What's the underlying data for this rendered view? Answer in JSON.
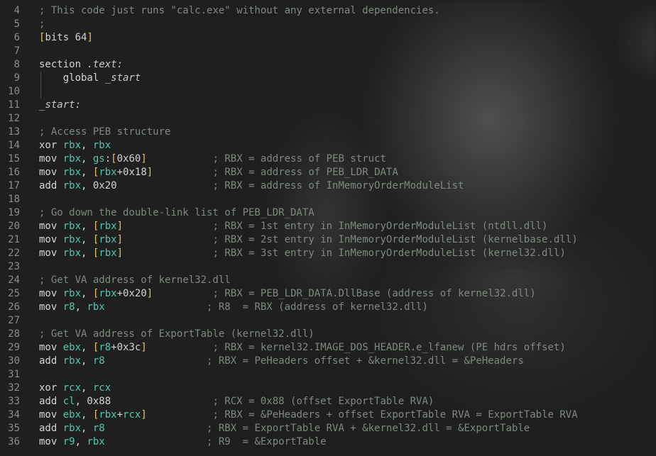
{
  "editor": {
    "lines": [
      {
        "n": "4",
        "segments": [
          {
            "t": "; This code just runs \"calc.exe\" without any external dependencies.",
            "c": "cmt"
          }
        ]
      },
      {
        "n": "5",
        "segments": [
          {
            "t": ";",
            "c": "cmt"
          }
        ]
      },
      {
        "n": "6",
        "segments": [
          {
            "t": "[",
            "c": "br"
          },
          {
            "t": "bits 64",
            "c": "plain"
          },
          {
            "t": "]",
            "c": "br"
          }
        ]
      },
      {
        "n": "7",
        "segments": []
      },
      {
        "n": "8",
        "segments": [
          {
            "t": "section ",
            "c": "plain"
          },
          {
            "t": ".text:",
            "c": "lbl"
          }
        ]
      },
      {
        "n": "9",
        "segments": [
          {
            "t": "    global ",
            "c": "plain"
          },
          {
            "t": "_start",
            "c": "lbl"
          }
        ]
      },
      {
        "n": "10",
        "segments": []
      },
      {
        "n": "11",
        "segments": [
          {
            "t": "_start:",
            "c": "lbl"
          }
        ]
      },
      {
        "n": "12",
        "segments": []
      },
      {
        "n": "13",
        "segments": [
          {
            "t": "; Access PEB structure",
            "c": "cmt"
          }
        ]
      },
      {
        "n": "14",
        "segments": [
          {
            "t": "xor ",
            "c": "kw"
          },
          {
            "t": "rbx",
            "c": "reg"
          },
          {
            "t": ", ",
            "c": "plain"
          },
          {
            "t": "rbx",
            "c": "reg"
          }
        ]
      },
      {
        "n": "15",
        "segments": [
          {
            "t": "mov ",
            "c": "kw"
          },
          {
            "t": "rbx",
            "c": "reg"
          },
          {
            "t": ", ",
            "c": "plain"
          },
          {
            "t": "gs",
            "c": "reg"
          },
          {
            "t": ":",
            "c": "plain"
          },
          {
            "t": "[",
            "c": "br"
          },
          {
            "t": "0x60",
            "c": "num"
          },
          {
            "t": "]",
            "c": "br"
          },
          {
            "t": "           ; RBX = address of PEB struct",
            "c": "cmt"
          }
        ]
      },
      {
        "n": "16",
        "segments": [
          {
            "t": "mov ",
            "c": "kw"
          },
          {
            "t": "rbx",
            "c": "reg"
          },
          {
            "t": ", ",
            "c": "plain"
          },
          {
            "t": "[",
            "c": "br"
          },
          {
            "t": "rbx",
            "c": "reg"
          },
          {
            "t": "+0x18",
            "c": "num"
          },
          {
            "t": "]",
            "c": "br"
          },
          {
            "t": "          ; RBX = address of PEB_LDR_DATA",
            "c": "cmt"
          }
        ]
      },
      {
        "n": "17",
        "segments": [
          {
            "t": "add ",
            "c": "kw"
          },
          {
            "t": "rbx",
            "c": "reg"
          },
          {
            "t": ", 0x20",
            "c": "num"
          },
          {
            "t": "                ; RBX = address of InMemoryOrderModuleList",
            "c": "cmt"
          }
        ]
      },
      {
        "n": "18",
        "segments": []
      },
      {
        "n": "19",
        "segments": [
          {
            "t": "; Go down the double-link list of PEB_LDR_DATA",
            "c": "cmt"
          }
        ]
      },
      {
        "n": "20",
        "segments": [
          {
            "t": "mov ",
            "c": "kw"
          },
          {
            "t": "rbx",
            "c": "reg"
          },
          {
            "t": ", ",
            "c": "plain"
          },
          {
            "t": "[",
            "c": "br"
          },
          {
            "t": "rbx",
            "c": "reg"
          },
          {
            "t": "]",
            "c": "br"
          },
          {
            "t": "               ; RBX = 1st entry in InMemoryOrderModuleList (ntdll.dll)",
            "c": "cmt"
          }
        ]
      },
      {
        "n": "21",
        "segments": [
          {
            "t": "mov ",
            "c": "kw"
          },
          {
            "t": "rbx",
            "c": "reg"
          },
          {
            "t": ", ",
            "c": "plain"
          },
          {
            "t": "[",
            "c": "br"
          },
          {
            "t": "rbx",
            "c": "reg"
          },
          {
            "t": "]",
            "c": "br"
          },
          {
            "t": "               ; RBX = 2st entry in InMemoryOrderModuleList (kernelbase.dll)",
            "c": "cmt"
          }
        ]
      },
      {
        "n": "22",
        "segments": [
          {
            "t": "mov ",
            "c": "kw"
          },
          {
            "t": "rbx",
            "c": "reg"
          },
          {
            "t": ", ",
            "c": "plain"
          },
          {
            "t": "[",
            "c": "br"
          },
          {
            "t": "rbx",
            "c": "reg"
          },
          {
            "t": "]",
            "c": "br"
          },
          {
            "t": "               ; RBX = 3st entry in InMemoryOrderModuleList (kernel32.dll)",
            "c": "cmt"
          }
        ]
      },
      {
        "n": "23",
        "segments": []
      },
      {
        "n": "24",
        "segments": [
          {
            "t": "; Get VA address of kernel32.dll",
            "c": "cmt"
          }
        ]
      },
      {
        "n": "25",
        "segments": [
          {
            "t": "mov ",
            "c": "kw"
          },
          {
            "t": "rbx",
            "c": "reg"
          },
          {
            "t": ", ",
            "c": "plain"
          },
          {
            "t": "[",
            "c": "br"
          },
          {
            "t": "rbx",
            "c": "reg"
          },
          {
            "t": "+0x20",
            "c": "num"
          },
          {
            "t": "]",
            "c": "br"
          },
          {
            "t": "          ; RBX = PEB_LDR_DATA.DllBase (address of kernel32.dll)",
            "c": "cmt"
          }
        ]
      },
      {
        "n": "26",
        "segments": [
          {
            "t": "mov ",
            "c": "kw"
          },
          {
            "t": "r8",
            "c": "reg"
          },
          {
            "t": ", ",
            "c": "plain"
          },
          {
            "t": "rbx",
            "c": "reg"
          },
          {
            "t": "                 ; R8  = RBX (address of kernel32.dll)",
            "c": "cmt"
          }
        ]
      },
      {
        "n": "27",
        "segments": []
      },
      {
        "n": "28",
        "segments": [
          {
            "t": "; Get VA address of ExportTable (kernel32.dll)",
            "c": "cmt"
          }
        ]
      },
      {
        "n": "29",
        "segments": [
          {
            "t": "mov ",
            "c": "kw"
          },
          {
            "t": "ebx",
            "c": "reg"
          },
          {
            "t": ", ",
            "c": "plain"
          },
          {
            "t": "[",
            "c": "br"
          },
          {
            "t": "r8",
            "c": "reg"
          },
          {
            "t": "+0x3c",
            "c": "num"
          },
          {
            "t": "]",
            "c": "br"
          },
          {
            "t": "           ; RBX = kernel32.IMAGE_DOS_HEADER.e_lfanew (PE hdrs offset)",
            "c": "cmt"
          }
        ]
      },
      {
        "n": "30",
        "segments": [
          {
            "t": "add ",
            "c": "kw"
          },
          {
            "t": "rbx",
            "c": "reg"
          },
          {
            "t": ", ",
            "c": "plain"
          },
          {
            "t": "r8",
            "c": "reg"
          },
          {
            "t": "                 ; RBX = PeHeaders offset + &kernel32.dll = &PeHeaders",
            "c": "cmt"
          }
        ]
      },
      {
        "n": "31",
        "segments": []
      },
      {
        "n": "32",
        "segments": [
          {
            "t": "xor ",
            "c": "kw"
          },
          {
            "t": "rcx",
            "c": "reg"
          },
          {
            "t": ", ",
            "c": "plain"
          },
          {
            "t": "rcx",
            "c": "reg"
          }
        ]
      },
      {
        "n": "33",
        "segments": [
          {
            "t": "add ",
            "c": "kw"
          },
          {
            "t": "cl",
            "c": "reg"
          },
          {
            "t": ", 0x88",
            "c": "num"
          },
          {
            "t": "                 ; RCX = 0x88 (offset ExportTable RVA)",
            "c": "cmt"
          }
        ]
      },
      {
        "n": "34",
        "segments": [
          {
            "t": "mov ",
            "c": "kw"
          },
          {
            "t": "ebx",
            "c": "reg"
          },
          {
            "t": ", ",
            "c": "plain"
          },
          {
            "t": "[",
            "c": "br"
          },
          {
            "t": "rbx",
            "c": "reg"
          },
          {
            "t": "+",
            "c": "plain"
          },
          {
            "t": "rcx",
            "c": "reg"
          },
          {
            "t": "]",
            "c": "br"
          },
          {
            "t": "           ; RBX = &PeHeaders + offset ExportTable RVA = ExportTable RVA",
            "c": "cmt"
          }
        ]
      },
      {
        "n": "35",
        "segments": [
          {
            "t": "add ",
            "c": "kw"
          },
          {
            "t": "rbx",
            "c": "reg"
          },
          {
            "t": ", ",
            "c": "plain"
          },
          {
            "t": "r8",
            "c": "reg"
          },
          {
            "t": "                 ; RBX = ExportTable RVA + &kernel32.dll = &ExportTable",
            "c": "cmt"
          }
        ]
      },
      {
        "n": "36",
        "segments": [
          {
            "t": "mov ",
            "c": "kw"
          },
          {
            "t": "r9",
            "c": "reg"
          },
          {
            "t": ", ",
            "c": "plain"
          },
          {
            "t": "rbx",
            "c": "reg"
          },
          {
            "t": "                 ; R9  = &ExportTable",
            "c": "cmt"
          }
        ]
      }
    ]
  }
}
